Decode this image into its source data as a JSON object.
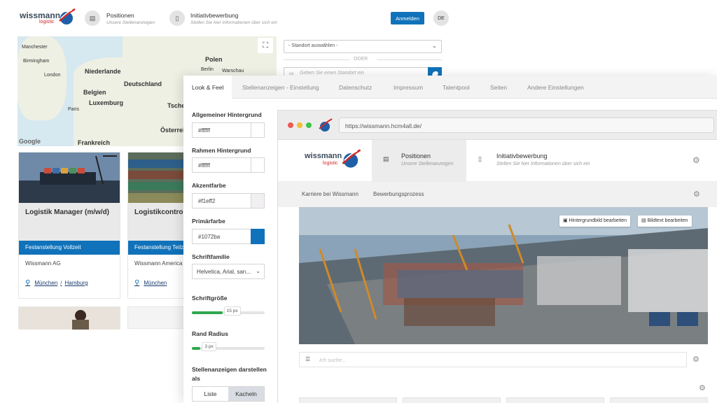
{
  "site": {
    "logo_name": "wissmann",
    "logo_sub": "logistic",
    "nav": [
      {
        "title": "Positionen",
        "subtitle": "Unsere Stellenanzeigen",
        "icon": "grid-icon"
      },
      {
        "title": "Initiativbewerbung",
        "subtitle": "Stellen Sie hier Informationen über sich ein",
        "icon": "document-icon"
      }
    ],
    "login_label": "Anmelden",
    "lang_label": "DE"
  },
  "map": {
    "countries": [
      "Polen",
      "Niederlande",
      "Deutschland",
      "Belgien",
      "Luxemburg",
      "Frankreich",
      "Österrei",
      "Tsche"
    ],
    "cities": [
      "Manchester",
      "Birmingham",
      "London",
      "Berlin",
      "Warschau",
      "Paris"
    ],
    "attribution": "Google"
  },
  "filters": {
    "location_select": "- Standort auswählen -",
    "or_label": "ODER",
    "location_placeholder": "Geben Sie einen Standort ein"
  },
  "jobs": [
    {
      "title": "Logistik Manager (m/w/d)",
      "type": "Festanstellung Vollzeit",
      "company": "Wissmann AG",
      "city1": "München",
      "city2": "Hamburg"
    },
    {
      "title": "Logistikcontrol",
      "type": "Festanstellung Teilz",
      "company": "Wissmann America",
      "city1": "München"
    }
  ],
  "settings": {
    "tabs": [
      "Look & Feel",
      "Stellenanzeigen - Einstellung",
      "Datenschutz",
      "Impressum",
      "Talentpool",
      "Seiten",
      "Andere Einstellungen"
    ],
    "general_bg_label": "Allgemeiner Hintergrund",
    "general_bg_value": "#ffffff",
    "frame_bg_label": "Rahmen Hintergrund",
    "frame_bg_value": "#ffffff",
    "accent_label": "Akzentfarbe",
    "accent_value": "#f1eff2",
    "primary_label": "Primärfarbe",
    "primary_value": "#1072ba",
    "font_family_label": "Schriftfamilie",
    "font_family_value": "Helvetica, Arial, san...",
    "font_size_label": "Schriftgröße",
    "font_size_value": "15 px",
    "font_size_fraction": 0.42,
    "radius_label": "Rand Radius",
    "radius_value": "3 px",
    "radius_fraction": 0.12,
    "display_label": "Stellenanzeigen darstellen als",
    "view_list": "Liste",
    "view_tiles": "Kacheln"
  },
  "preview": {
    "url": "https://wissmann.hcm4all.de/",
    "logo_name": "wissmann",
    "logo_sub": "logistic",
    "nav": [
      {
        "title": "Positionen",
        "subtitle": "Unsere Stellenanzeigen"
      },
      {
        "title": "Initiativbewerbung",
        "subtitle": "Stellen Sie hier Informationen über sich ein"
      }
    ],
    "subnav": [
      "Karriere bei Wissmann",
      "Bewerbungsprozess"
    ],
    "edit_bg_label": "Hintergrundbild bearbeiten",
    "edit_text_label": "Bildtext bearbeiten",
    "search_placeholder": "Ich suche..."
  },
  "colors": {
    "primary": "#1072ba",
    "accent": "#f1eff2",
    "slider": "#2fa84f"
  }
}
